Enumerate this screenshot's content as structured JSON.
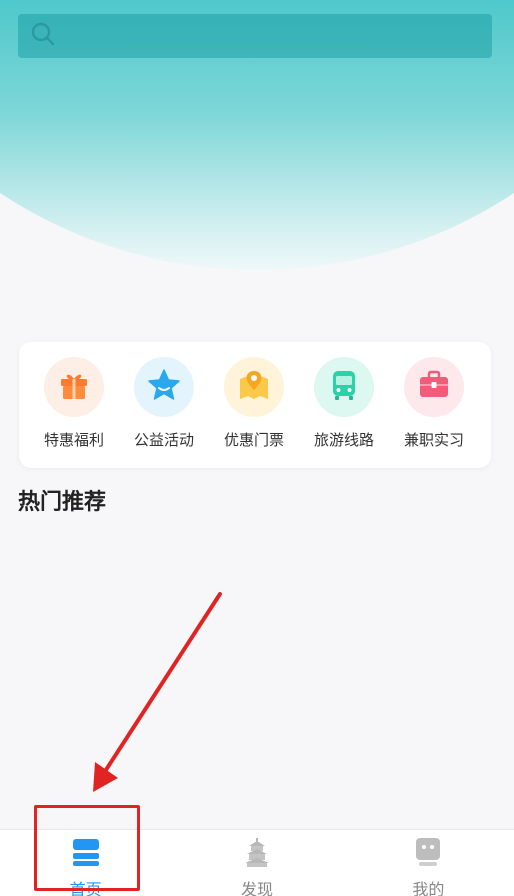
{
  "search": {
    "placeholder": ""
  },
  "categories": [
    {
      "label": "特惠福利",
      "icon": "gift-icon",
      "bg": "#fdeee6",
      "color": "#ff7a2e"
    },
    {
      "label": "公益活动",
      "icon": "star-icon",
      "bg": "#e4f4fd",
      "color": "#29a8ee"
    },
    {
      "label": "优惠门票",
      "icon": "map-pin-icon",
      "bg": "#fff4da",
      "color": "#f5b628"
    },
    {
      "label": "旅游线路",
      "icon": "bus-icon",
      "bg": "#ddf8f1",
      "color": "#27d3a7"
    },
    {
      "label": "兼职实习",
      "icon": "briefcase-icon",
      "bg": "#fde8ec",
      "color": "#f35b7a"
    }
  ],
  "section": {
    "title": "热门推荐"
  },
  "tabbar": {
    "items": [
      {
        "label": "首页",
        "icon": "home-layers-icon",
        "active": true
      },
      {
        "label": "发现",
        "icon": "pagoda-icon",
        "active": false
      },
      {
        "label": "我的",
        "icon": "profile-icon",
        "active": false
      }
    ]
  },
  "colors": {
    "accent": "#2196f3",
    "hero": "#3ec3c7",
    "annotation": "#e02424"
  }
}
